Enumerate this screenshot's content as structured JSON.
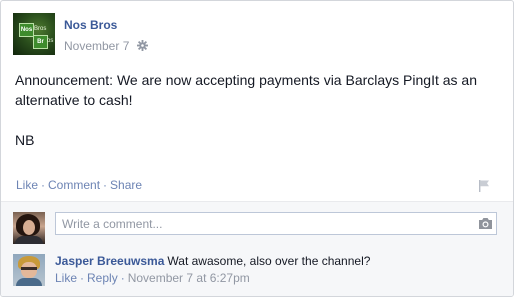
{
  "post": {
    "page_name": "Nos Bros",
    "avatar": {
      "tile1": "Nos",
      "word1": "Bros",
      "tile2": "Br",
      "word2": "os"
    },
    "date": "November 7",
    "audience_icon": "gear-icon",
    "body_line": "Announcement: We are now accepting payments via Barclays PingIt as an alternative to cash!",
    "signature": "NB",
    "actions": {
      "like": "Like",
      "comment": "Comment",
      "share": "Share",
      "separator": "·"
    },
    "flag_icon": "flag-icon"
  },
  "comment_box": {
    "placeholder": "Write a comment...",
    "camera_icon": "camera-icon"
  },
  "comments": [
    {
      "author": "Jasper Breeuwsma",
      "text": "Wat awasome, also over the channel?",
      "like": "Like",
      "reply": "Reply",
      "timestamp": "November 7 at 6:27pm"
    }
  ],
  "colors": {
    "link": "#3b5998",
    "action": "#6d84b4",
    "meta": "#9197a3",
    "text": "#141823",
    "border": "#d3d6db",
    "comment_bg": "#f6f7f9"
  }
}
